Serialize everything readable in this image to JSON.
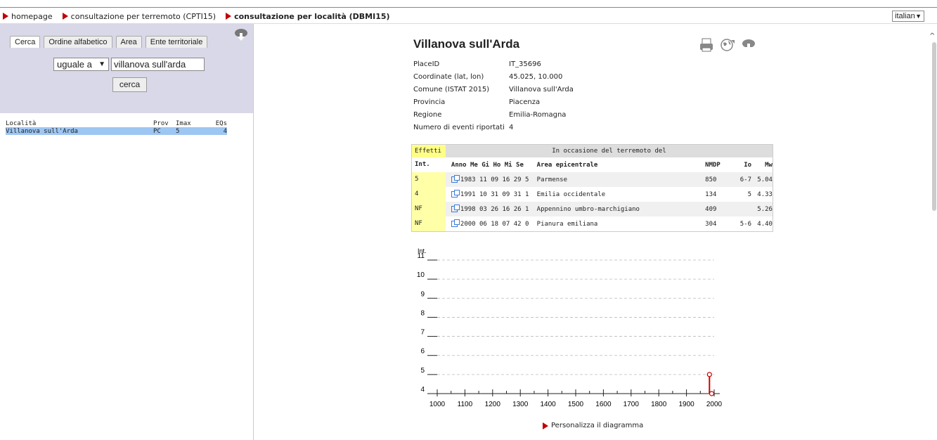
{
  "nav": {
    "items": [
      {
        "label": "homepage"
      },
      {
        "label": "consultazione per terremoto (CPTI15)"
      },
      {
        "label": "consultazione per località (DBMI15)"
      }
    ],
    "language": "italian"
  },
  "search": {
    "tabs": [
      "Cerca",
      "Ordine alfabetico",
      "Area",
      "Ente territoriale"
    ],
    "operator": "uguale a",
    "query": "villanova sull'arda",
    "button": "cerca"
  },
  "results": {
    "headers": [
      "Località",
      "Prov",
      "Imax",
      "EQs"
    ],
    "rows": [
      {
        "loc": "Villanova sull'Arda",
        "prov": "PC",
        "imax": "5",
        "eqs": "4"
      }
    ]
  },
  "place": {
    "title": "Villanova sull'Arda",
    "fields": [
      {
        "k": "PlaceID",
        "v": "IT_35696"
      },
      {
        "k": "Coordinate (lat, lon)",
        "v": "45.025, 10.000"
      },
      {
        "k": "Comune (ISTAT 2015)",
        "v": "Villanova sull'Arda"
      },
      {
        "k": "Provincia",
        "v": "Piacenza"
      },
      {
        "k": "Regione",
        "v": "Emilia-Romagna"
      },
      {
        "k": "Numero di eventi riportati",
        "v": "4"
      }
    ]
  },
  "events": {
    "effetti": "Effetti",
    "occasion": "In occasione del terremoto del",
    "headers": [
      "Int.",
      "Anno Me Gi Ho Mi Se",
      "Area epicentrale",
      "NMDP",
      "Io",
      "Mw"
    ],
    "rows": [
      {
        "int": "5",
        "date": "1983 11 09 16 29 5",
        "area": "Parmense",
        "nmdp": "850",
        "io": "6-7",
        "mw": "5.04"
      },
      {
        "int": "4",
        "date": "1991 10 31 09 31 1",
        "area": "Emilia occidentale",
        "nmdp": "134",
        "io": "5",
        "mw": "4.33"
      },
      {
        "int": "NF",
        "date": "1998 03 26 16 26 1",
        "area": "Appennino umbro-marchigiano",
        "nmdp": "409",
        "io": "",
        "mw": "5.26"
      },
      {
        "int": "NF",
        "date": "2000 06 18 07 42 0",
        "area": "Pianura emiliana",
        "nmdp": "304",
        "io": "5-6",
        "mw": "4.40"
      }
    ]
  },
  "chart_data": {
    "type": "scatter",
    "ylabel": "Int.",
    "xlabel": "",
    "xlim": [
      1000,
      2000
    ],
    "ylim": [
      4,
      11
    ],
    "xticks": [
      1000,
      1100,
      1200,
      1300,
      1400,
      1500,
      1600,
      1700,
      1800,
      1900,
      2000
    ],
    "yticks": [
      4,
      5,
      6,
      7,
      8,
      9,
      10,
      11
    ],
    "grid": true,
    "points": [
      {
        "x": 1983,
        "y": 5
      },
      {
        "x": 1991,
        "y": 4
      }
    ],
    "color": "#cc0000"
  },
  "customize_label": "Personalizza il diagramma"
}
